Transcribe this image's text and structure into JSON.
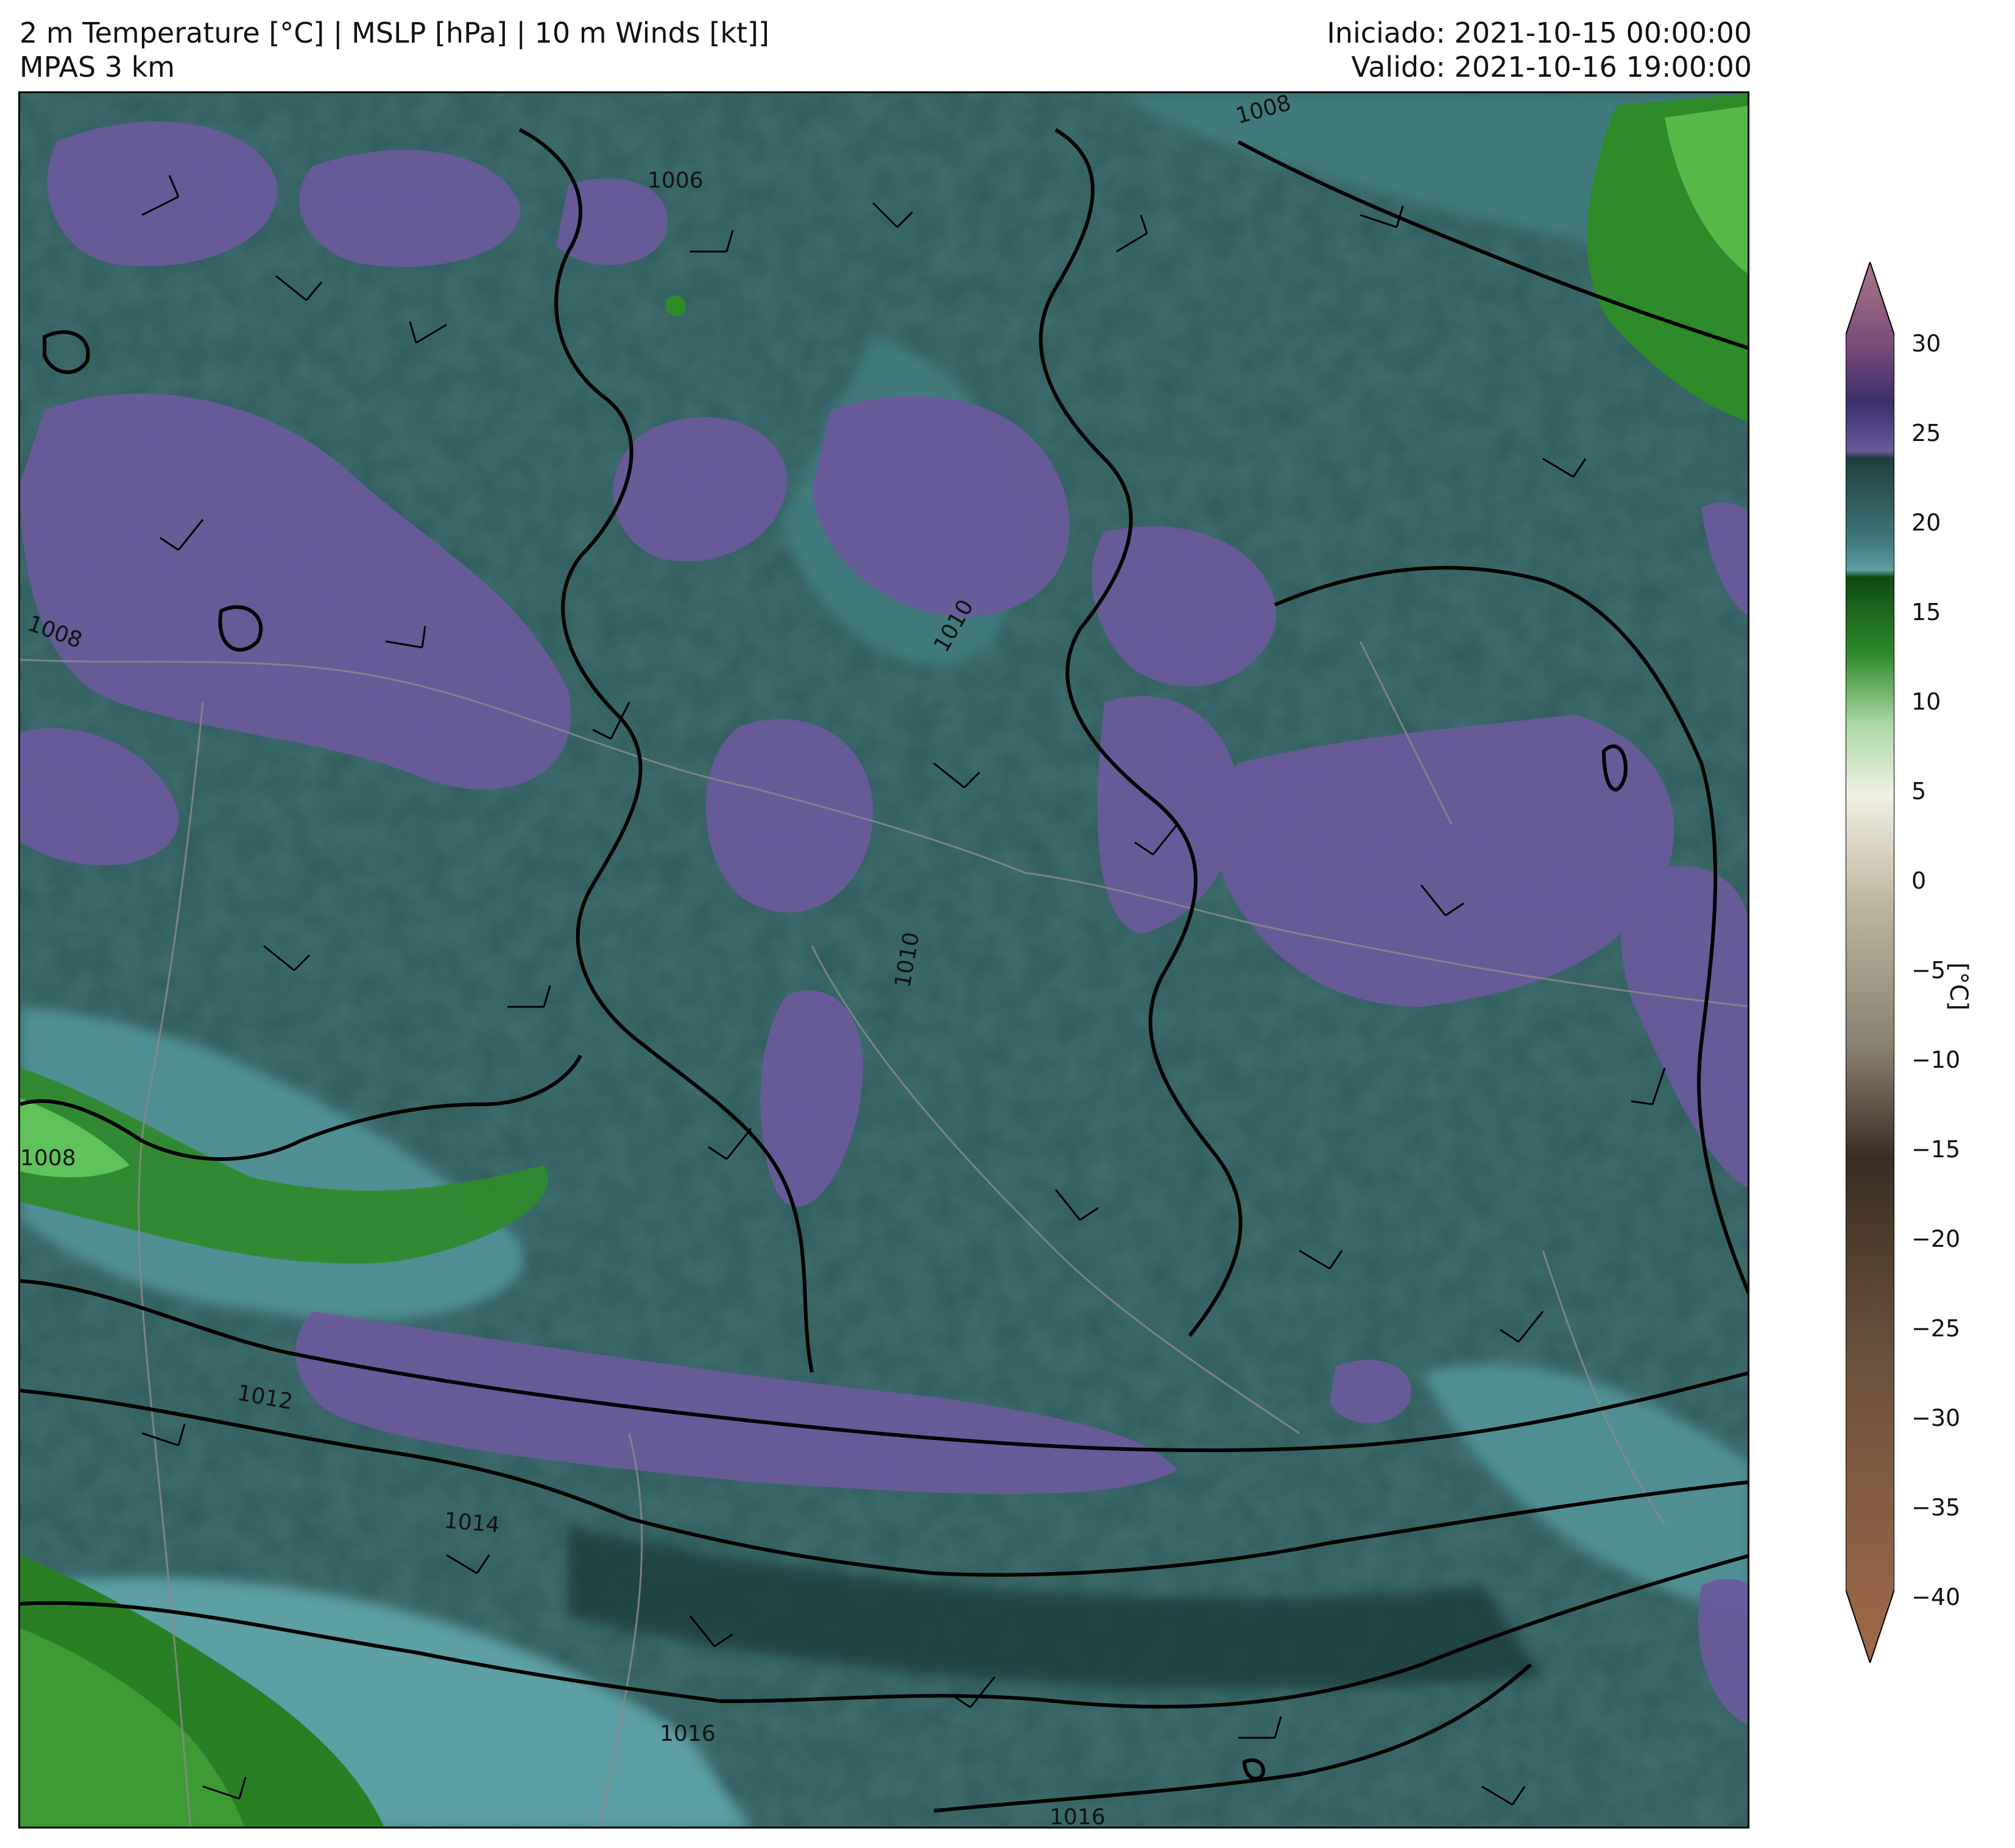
{
  "header": {
    "title": "2 m Temperature [°C] | MSLP [hPa] | 10 m Winds [kt]]",
    "subtitle": "MPAS 3 km",
    "init": "Iniciado: 2021-10-15 00:00:00",
    "valid": "Valido: 2021-10-16 19:00:00"
  },
  "map": {
    "isobar_labels": [
      "1006",
      "1008",
      "1008",
      "1010",
      "1010",
      "1012",
      "1014",
      "1016",
      "1016",
      "1008"
    ]
  },
  "colorbar": {
    "label": "[°C]",
    "ticks": [
      "30",
      "25",
      "20",
      "15",
      "10",
      "5",
      "0",
      "−5",
      "−10",
      "−15",
      "−20",
      "−25",
      "−30",
      "−35",
      "−40"
    ],
    "range": [
      -40,
      30
    ],
    "colors": {
      "warm_end": "#a87888",
      "purple": "#6a5a9c",
      "dark_teal": "#1f3d3c",
      "teal": "#5c9fa4",
      "green": "#2f8a2a",
      "pale": "#e9e4d4",
      "gray_brown": "#8a8070",
      "dark_brown": "#3a2e22",
      "brown_end": "#a06a48"
    }
  }
}
